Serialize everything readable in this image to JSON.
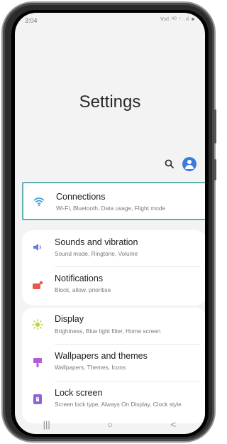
{
  "status_bar": {
    "time": "3:04",
    "icons_text": "Vol ᴴᴰ ᵗ .ıl ■"
  },
  "header": {
    "title": "Settings"
  },
  "toolbar": {
    "search_icon": "search-icon",
    "account_icon": "account-icon"
  },
  "menu": [
    {
      "label": "Connections",
      "sub": "Wi-Fi, Bluetooth, Data usage, Flight mode",
      "icon": "wifi-icon",
      "color": "#3aa1d6",
      "highlighted": true
    },
    {
      "label": "Sounds and vibration",
      "sub": "Sound mode, Ringtone, Volume",
      "icon": "volume-icon",
      "color": "#6a7bdc"
    },
    {
      "label": "Notifications",
      "sub": "Block, allow, prioritise",
      "icon": "notifications-icon",
      "color": "#e35a4e"
    },
    {
      "label": "Display",
      "sub": "Brightness, Blue light filter, Home screen",
      "icon": "brightness-icon",
      "color": "#b7d33d"
    },
    {
      "label": "Wallpapers and themes",
      "sub": "Wallpapers, Themes, Icons",
      "icon": "paintbrush-icon",
      "color": "#b65bd8"
    },
    {
      "label": "Lock screen",
      "sub": "Screen lock type, Always On Display, Clock style",
      "icon": "lock-icon",
      "color": "#8e63d8"
    }
  ],
  "nav_bar": {
    "recents": "|||",
    "home": "○",
    "back": "<"
  },
  "colors": {
    "highlight_border": "#5fb0b2",
    "account": "#3a7be0",
    "background": "#f3f3f3"
  }
}
